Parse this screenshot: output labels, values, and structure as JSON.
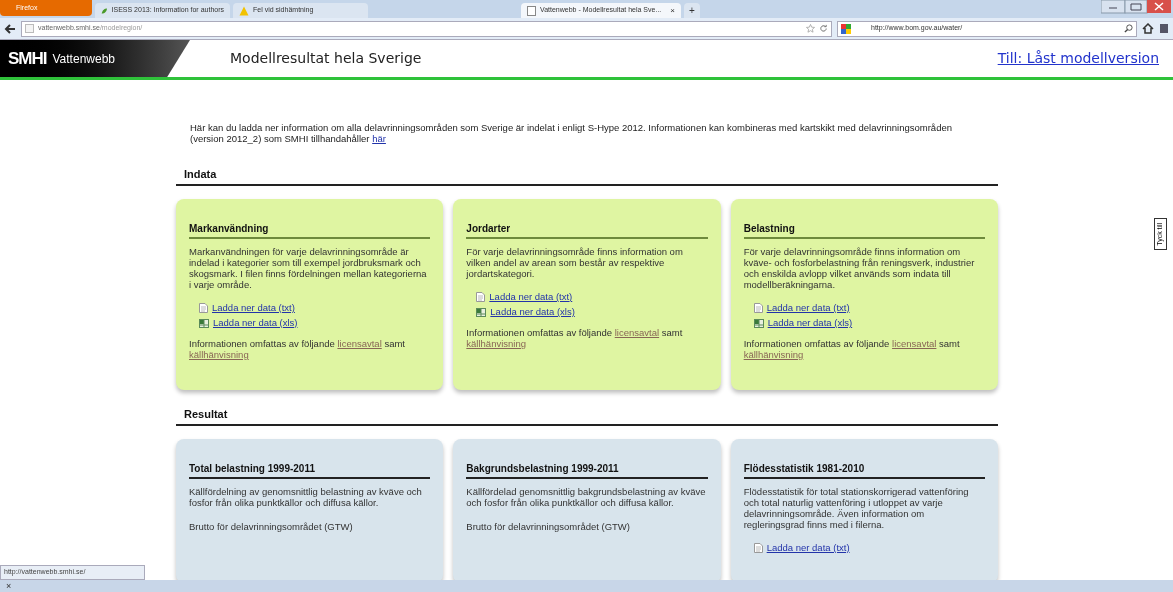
{
  "browser": {
    "menu_button": "Firefox",
    "tabs": [
      {
        "title": "ISESS 2013: Information for authors",
        "selected": false,
        "kind": "leaf"
      },
      {
        "title": "Fel vid sidhämtning",
        "selected": false,
        "kind": "warning"
      },
      {
        "title": "Vattenwebb - Modellresultat hela Sve...",
        "selected": true,
        "kind": "page"
      }
    ],
    "new_tab": "+",
    "close_tab": "×",
    "address": {
      "host": "vattenwebb.smhi.se",
      "path": "/modelregion/"
    },
    "search": "http://www.bom.gov.au/water/"
  },
  "header": {
    "logo": "SMHI",
    "site": "Vattenwebb",
    "title": "Modellresultat hela Sverige",
    "link": "Till: Låst modellversion"
  },
  "intro": {
    "text": "Här kan du ladda ner information om alla delavrinningsområden som Sverige är indelat i enligt S-Hype 2012. Informationen kan kombineras med kartskikt med delavrinningsområden (version 2012_2) som SMHI tillhandahåller",
    "link": "här"
  },
  "sections": [
    {
      "title": "Indata",
      "kind": "input",
      "cards": [
        {
          "title": "Markanvändning",
          "text": "Markanvändningen för varje delavrinningsområde är indelad i kategorier som till exempel jordbruksmark och skogsmark. I filen finns fördelningen mellan kategorierna i varje område.",
          "downloads": [
            {
              "label": "Ladda ner data (txt)",
              "kind": "txt"
            },
            {
              "label": "Ladda ner data (xls)",
              "kind": "xls"
            }
          ],
          "license": {
            "prefix": "Informationen omfattas av följande",
            "link": "licensavtal",
            "middle": "samt",
            "link2": "källhänvisning"
          }
        },
        {
          "title": "Jordarter",
          "text": "För varje delavrinningsområde finns information om vilken andel av arean som består av respektive jordartskategori.",
          "downloads": [
            {
              "label": "Ladda ner data (txt)",
              "kind": "txt"
            },
            {
              "label": "Ladda ner data (xls)",
              "kind": "xls"
            }
          ],
          "license": {
            "prefix": "Informationen omfattas av följande",
            "link": "licensavtal",
            "middle": "samt",
            "link2": "källhänvisning"
          }
        },
        {
          "title": "Belastning",
          "text": "För varje delavrinningsområde finns information om kväve- och fosforbelastning från reningsverk, industrier och enskilda avlopp vilket används som indata till modellberäkningarna.",
          "downloads": [
            {
              "label": "Ladda ner data (txt)",
              "kind": "txt"
            },
            {
              "label": "Ladda ner data (xls)",
              "kind": "xls"
            }
          ],
          "license": {
            "prefix": "Informationen omfattas av följande",
            "link": "licensavtal",
            "middle": "samt",
            "link2": "källhänvisning"
          }
        }
      ]
    },
    {
      "title": "Resultat",
      "kind": "result",
      "cards": [
        {
          "title": "Total belastning 1999-2011",
          "text": "Källfördelning av genomsnittlig belastning av kväve och fosfor från olika punktkällor och diffusa källor.",
          "subtitle": "Brutto för delavrinningsområdet (GTW)"
        },
        {
          "title": "Bakgrundsbelastning 1999-2011",
          "text": "Källfördelad genomsnittlig bakgrundsbelastning av kväve och fosfor från olika punktkällor och diffusa källor.",
          "subtitle": "Brutto för delavrinningsområdet (GTW)"
        },
        {
          "title": "Flödesstatistik 1981-2010",
          "text": "Flödesstatistik för total stationskorrigerad vattenföring och total naturlig vattenföring i utloppet av varje delavrinningsområde. Även information om regleringsgrad finns med i filerna.",
          "downloads": [
            {
              "label": "Ladda ner data (txt)",
              "kind": "txt"
            }
          ]
        }
      ]
    }
  ],
  "feedback_tab": "Tyck till",
  "status_url": "http://vattenwebb.smhi.se/",
  "bottom_bar": {
    "close": "×"
  }
}
